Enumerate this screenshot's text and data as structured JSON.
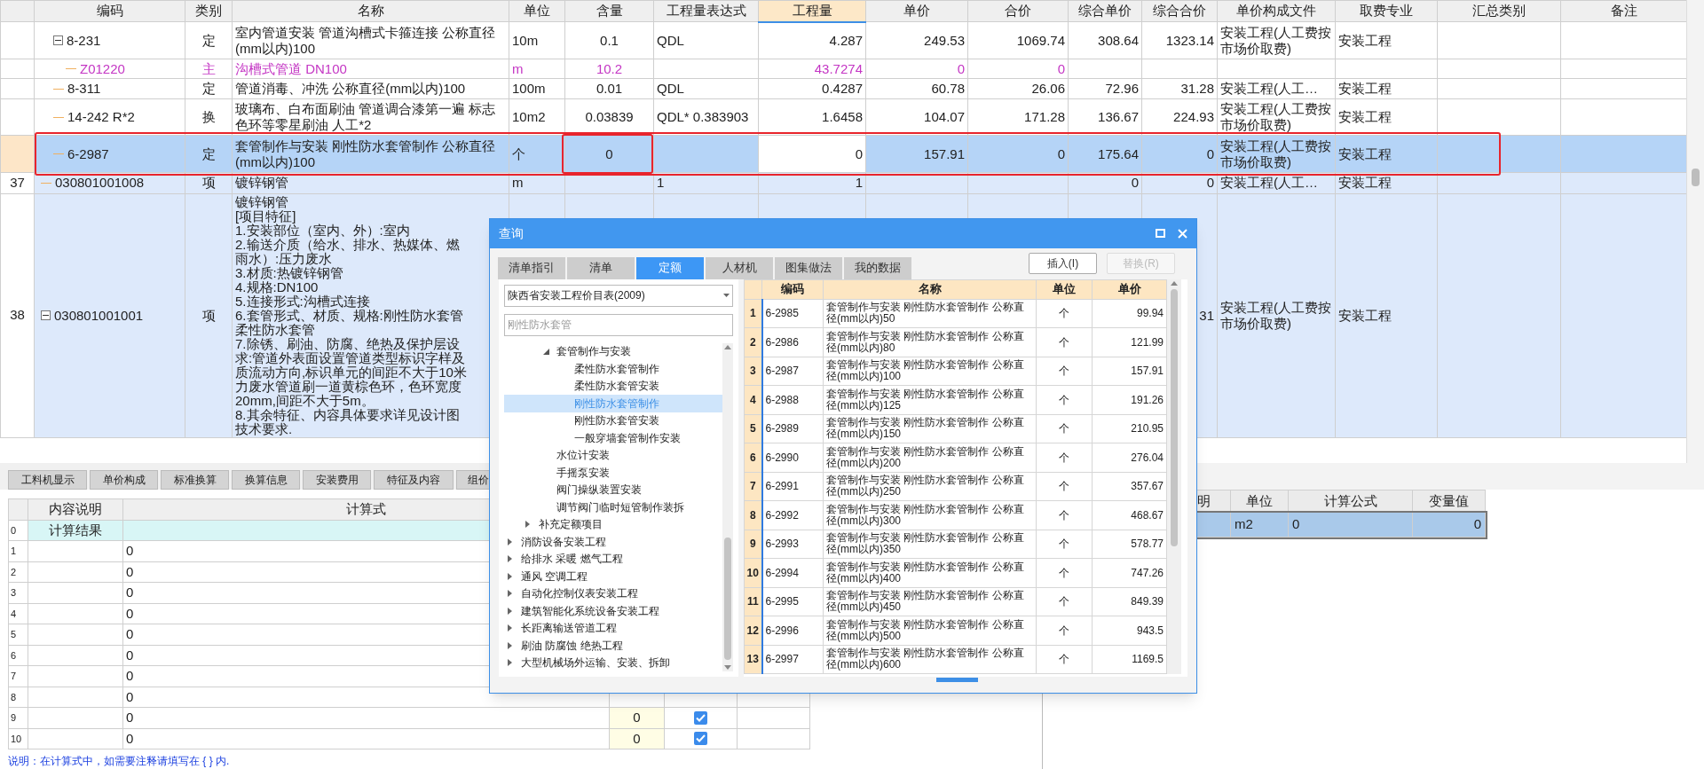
{
  "main_table": {
    "columns": [
      {
        "label": "编码",
        "active": false
      },
      {
        "label": "类别",
        "active": false
      },
      {
        "label": "名称",
        "active": false
      },
      {
        "label": "单位",
        "active": false
      },
      {
        "label": "含量",
        "active": false
      },
      {
        "label": "工程量表达式",
        "active": false
      },
      {
        "label": "工程量",
        "active": true
      },
      {
        "label": "单价",
        "active": false
      },
      {
        "label": "合价",
        "active": false
      },
      {
        "label": "综合单价",
        "active": false
      },
      {
        "label": "综合合价",
        "active": false
      },
      {
        "label": "单价构成文件",
        "active": false
      },
      {
        "label": "取费专业",
        "active": false
      },
      {
        "label": "汇总类别",
        "active": false
      },
      {
        "label": "备注",
        "active": false
      }
    ],
    "rows": [
      {
        "children": [
          {
            "kind": "quota",
            "selected": false,
            "expanded": true,
            "cells": {
              "code": "8-231",
              "category": "定",
              "name": "室内管道安装 管道沟槽式卡箍连接 公称直径(mm以内)100",
              "unit": "10m",
              "content": "0.1",
              "qty_expr": "QDL",
              "qty": "4.287",
              "unit_price": "249.53",
              "total_price": "1069.74",
              "comp_unit_price": "308.64",
              "comp_total_price": "1323.14",
              "price_file": "安装工程(人工费按市场价取费)",
              "fee_type": "安装工程"
            },
            "children": [
              {
                "kind": "main_material",
                "selected": false,
                "cells": {
                  "code": "Z01220",
                  "category": "主",
                  "name": "沟槽式管道 DN100",
                  "unit": "m",
                  "content": "10.2",
                  "qty": "43.7274",
                  "unit_price": "0",
                  "total_price": "0"
                }
              }
            ]
          },
          {
            "kind": "quota",
            "selected": false,
            "cells": {
              "code": "8-311",
              "category": "定",
              "name": "管道消毒、冲洗 公称直径(mm以内)100",
              "unit": "100m",
              "content": "0.01",
              "qty_expr": "QDL",
              "qty": "0.4287",
              "unit_price": "60.78",
              "total_price": "26.06",
              "comp_unit_price": "72.96",
              "comp_total_price": "31.28",
              "price_file": "安装工程(人工…",
              "fee_type": "安装工程"
            }
          },
          {
            "kind": "quota",
            "selected": false,
            "cells": {
              "code": "14-242 R*2",
              "category": "换",
              "name": "玻璃布、白布面刷油 管道调合漆第一遍 标志色环等零星刷油  人工*2",
              "unit": "10m2",
              "content": "0.03839",
              "qty_expr": "QDL* 0.383903",
              "qty": "1.6458",
              "unit_price": "104.07",
              "total_price": "171.28",
              "comp_unit_price": "136.67",
              "comp_total_price": "224.93",
              "price_file": "安装工程(人工费按市场价取费)",
              "fee_type": "安装工程"
            }
          },
          {
            "kind": "quota",
            "selected": true,
            "highlight": true,
            "content_highlight": true,
            "cells": {
              "code": "6-2987",
              "category": "定",
              "name": "套管制作与安装 刚性防水套管制作 公称直径(mm以内)100",
              "unit": "个",
              "content": "0",
              "qty": "0",
              "unit_price": "157.91",
              "total_price": "0",
              "comp_unit_price": "175.64",
              "comp_total_price": "0",
              "price_file": "安装工程(人工费按市场价取费)",
              "fee_type": "安装工程"
            }
          }
        ]
      },
      {
        "kind": "bill",
        "num": "37",
        "selected": false,
        "cells": {
          "code": "030801001008",
          "category": "项",
          "name": "镀锌钢管",
          "unit": "m",
          "qty_expr": "1",
          "qty": "1",
          "comp_unit_price": "0",
          "comp_total_price": "0",
          "price_file": "安装工程(人工…",
          "fee_type": "安装工程"
        }
      },
      {
        "kind": "bill",
        "num": "38",
        "selected": false,
        "expanded": true,
        "cells": {
          "code": "030801001001",
          "category": "项",
          "comp_total_price": "31",
          "price_file": "安装工程(人工费按市场价取费)",
          "fee_type": "安装工程"
        },
        "name_lines": [
          "镀锌钢管",
          "[项目特征]",
          "1.安装部位（室内、外）:室内",
          "2.输送介质（给水、排水、热媒体、燃",
          "雨水）:压力废水",
          "3.材质:热镀锌钢管",
          "4.规格:DN100",
          "5.连接形式:沟槽式连接",
          "6.套管形式、材质、规格:刚性防水套管",
          "柔性防水套管",
          "7.除锈、刷油、防腐、绝热及保护层设",
          "求:管道外表面设置管道类型标识字样及",
          "质流动方向,标识单元的间距不大于10米",
          "力废水管道刷一道黄棕色环，色环宽度",
          "20mm,间距不大于5m。",
          "8.其余特征、内容具体要求详见设计图",
          "技术要求."
        ]
      }
    ]
  },
  "bottom_tabs": [
    "工料机显示",
    "单价构成",
    "标准换算",
    "换算信息",
    "安装费用",
    "特征及内容",
    "组价"
  ],
  "calc_table": {
    "columns": [
      "内容说明",
      "计算式"
    ],
    "rows": [
      {
        "kind": "result",
        "num": "0",
        "description": "计算结果"
      },
      {
        "kind": "line",
        "num": "1",
        "formula": "0"
      },
      {
        "kind": "line",
        "num": "2",
        "formula": "0"
      },
      {
        "kind": "line",
        "num": "3",
        "formula": "0"
      },
      {
        "kind": "line",
        "num": "4",
        "formula": "0"
      },
      {
        "kind": "line",
        "num": "5",
        "formula": "0"
      },
      {
        "kind": "line",
        "num": "6",
        "formula": "0"
      },
      {
        "kind": "line",
        "num": "7",
        "formula": "0"
      },
      {
        "kind": "line",
        "num": "8",
        "formula": "0"
      },
      {
        "kind": "line",
        "num": "9",
        "formula": "0",
        "column_4": "0",
        "checked": true
      },
      {
        "kind": "line",
        "num": "10",
        "formula": "0",
        "column_4": "0",
        "checked": true
      }
    ]
  },
  "variable_table": {
    "columns": [
      "明",
      "单位",
      "计算公式",
      "变量值"
    ],
    "rows": [
      {
        "selected": true,
        "unit": "m2",
        "formula": "0",
        "value": "0"
      }
    ]
  },
  "note": "说明：在计算式中，如需要注释请填写在 { } 内.",
  "dialog": {
    "title": "查询",
    "tabs": [
      {
        "label": "清单指引",
        "selected": false
      },
      {
        "label": "清单",
        "selected": false
      },
      {
        "label": "定额",
        "selected": true
      },
      {
        "label": "人材机",
        "selected": false
      },
      {
        "label": "图集做法",
        "selected": false
      },
      {
        "label": "我的数据",
        "selected": false
      }
    ],
    "buttons": [
      {
        "label": "插入(I)",
        "disabled": false
      },
      {
        "label": "替换(R)",
        "disabled": true
      }
    ],
    "library": "陕西省安装工程价目表(2009)",
    "search": {
      "placeholder": "刚性防水套管"
    },
    "tree": [
      {
        "children": [
          {
            "children": [
              {
                "label": "套管制作与安装",
                "selected": false,
                "expanded": true,
                "children": [
                  {
                    "label": "柔性防水套管制作",
                    "selected": false
                  },
                  {
                    "label": "柔性防水套管安装",
                    "selected": false
                  },
                  {
                    "label": "刚性防水套管制作",
                    "selected": true
                  },
                  {
                    "label": "刚性防水套管安装",
                    "selected": false
                  },
                  {
                    "label": "一般穿墙套管制作安装",
                    "selected": false
                  }
                ]
              },
              {
                "label": "水位计安装",
                "selected": false
              },
              {
                "label": "手摇泵安装",
                "selected": false
              },
              {
                "label": "阀门操纵装置安装",
                "selected": false
              },
              {
                "label": "调节阀门临时短管制作装拆",
                "selected": false
              }
            ]
          },
          {
            "label": "补充定额项目",
            "selected": false,
            "expanded": false
          }
        ]
      },
      {
        "label": "消防设备安装工程",
        "selected": false,
        "expanded": false
      },
      {
        "label": "给排水 采暖 燃气工程",
        "selected": false,
        "expanded": false
      },
      {
        "label": "通风 空调工程",
        "selected": false,
        "expanded": false
      },
      {
        "label": "自动化控制仪表安装工程",
        "selected": false,
        "expanded": false
      },
      {
        "label": "建筑智能化系统设备安装工程",
        "selected": false,
        "expanded": false
      },
      {
        "label": "长距离输送管道工程",
        "selected": false,
        "expanded": false
      },
      {
        "label": "刷油 防腐蚀 绝热工程",
        "selected": false,
        "expanded": false
      },
      {
        "label": "大型机械场外运输、安装、拆卸",
        "selected": false,
        "expanded": false
      }
    ],
    "grid": {
      "columns": [
        "编码",
        "名称",
        "单位",
        "单价"
      ],
      "rows": [
        {
          "num": "1",
          "code": "6-2985",
          "name": "套管制作与安装 刚性防水套管制作 公称直径(mm以内)50",
          "unit": "个",
          "price": "99.94"
        },
        {
          "num": "2",
          "code": "6-2986",
          "name": "套管制作与安装 刚性防水套管制作 公称直径(mm以内)80",
          "unit": "个",
          "price": "121.99"
        },
        {
          "num": "3",
          "code": "6-2987",
          "name": "套管制作与安装 刚性防水套管制作 公称直径(mm以内)100",
          "unit": "个",
          "price": "157.91"
        },
        {
          "num": "4",
          "code": "6-2988",
          "name": "套管制作与安装 刚性防水套管制作 公称直径(mm以内)125",
          "unit": "个",
          "price": "191.26"
        },
        {
          "num": "5",
          "code": "6-2989",
          "name": "套管制作与安装 刚性防水套管制作 公称直径(mm以内)150",
          "unit": "个",
          "price": "210.95"
        },
        {
          "num": "6",
          "code": "6-2990",
          "name": "套管制作与安装 刚性防水套管制作 公称直径(mm以内)200",
          "unit": "个",
          "price": "276.04"
        },
        {
          "num": "7",
          "code": "6-2991",
          "name": "套管制作与安装 刚性防水套管制作 公称直径(mm以内)250",
          "unit": "个",
          "price": "357.67"
        },
        {
          "num": "8",
          "code": "6-2992",
          "name": "套管制作与安装 刚性防水套管制作 公称直径(mm以内)300",
          "unit": "个",
          "price": "468.67"
        },
        {
          "num": "9",
          "code": "6-2993",
          "name": "套管制作与安装 刚性防水套管制作 公称直径(mm以内)350",
          "unit": "个",
          "price": "578.77"
        },
        {
          "num": "10",
          "code": "6-2994",
          "name": "套管制作与安装 刚性防水套管制作 公称直径(mm以内)400",
          "unit": "个",
          "price": "747.26"
        },
        {
          "num": "11",
          "code": "6-2995",
          "name": "套管制作与安装 刚性防水套管制作 公称直径(mm以内)450",
          "unit": "个",
          "price": "849.39"
        },
        {
          "num": "12",
          "code": "6-2996",
          "name": "套管制作与安装 刚性防水套管制作 公称直径(mm以内)500",
          "unit": "个",
          "price": "943.5"
        },
        {
          "num": "13",
          "code": "6-2997",
          "name": "套管制作与安装 刚性防水套管制作 公称直径(mm以内)600",
          "unit": "个",
          "price": "1169.5"
        }
      ]
    }
  }
}
